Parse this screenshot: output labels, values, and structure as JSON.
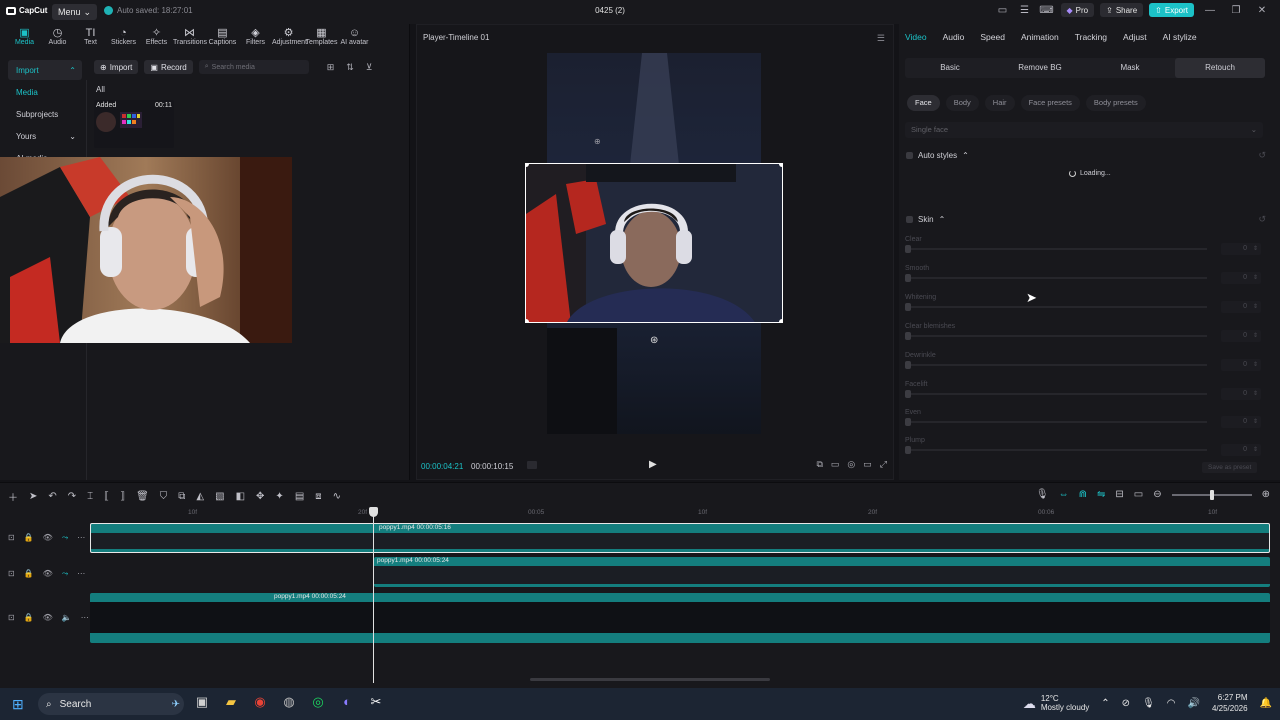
{
  "titlebar": {
    "app_name": "CapCut",
    "menu_label": "Menu",
    "autosave": "Auto saved: 18:27:01",
    "project_title": "0425 (2)",
    "pro_label": "Pro",
    "share_label": "Share",
    "export_label": "Export"
  },
  "tools": [
    {
      "label": "Media",
      "icon": "media-icon"
    },
    {
      "label": "Audio",
      "icon": "audio-icon"
    },
    {
      "label": "Text",
      "icon": "text-icon"
    },
    {
      "label": "Stickers",
      "icon": "stickers-icon"
    },
    {
      "label": "Effects",
      "icon": "effects-icon"
    },
    {
      "label": "Transitions",
      "icon": "transitions-icon"
    },
    {
      "label": "Captions",
      "icon": "captions-icon"
    },
    {
      "label": "Filters",
      "icon": "filters-icon"
    },
    {
      "label": "Adjustment",
      "icon": "adjustment-icon"
    },
    {
      "label": "Templates",
      "icon": "templates-icon"
    },
    {
      "label": "AI avatar",
      "icon": "ai-avatar-icon"
    }
  ],
  "leftnav": {
    "import": "Import",
    "media": "Media",
    "subprojects": "Subprojects",
    "yours": "Yours",
    "ai_media": "AI media"
  },
  "media": {
    "import_btn": "Import",
    "record_btn": "Record",
    "search_placeholder": "Search media",
    "all_label": "All",
    "thumb_added": "Added",
    "thumb_duration": "00:11"
  },
  "player": {
    "title": "Player-Timeline 01",
    "current_time": "00:00:04:21",
    "total_time": "00:00:10:15"
  },
  "right": {
    "tabs": [
      "Video",
      "Audio",
      "Speed",
      "Animation",
      "Tracking",
      "Adjust",
      "AI stylize"
    ],
    "subtabs": [
      "Basic",
      "Remove BG",
      "Mask",
      "Retouch"
    ],
    "chips": [
      "Face",
      "Body",
      "Hair",
      "Face presets",
      "Body presets"
    ],
    "dropdown": "Single face",
    "auto_styles": "Auto styles",
    "loading": "Loading...",
    "skin": "Skin",
    "sliders": [
      {
        "label": "Clear",
        "value": "0"
      },
      {
        "label": "Smooth",
        "value": "0"
      },
      {
        "label": "Whitening",
        "value": "0"
      },
      {
        "label": "Clear blemishes",
        "value": "0"
      },
      {
        "label": "Dewrinkle",
        "value": "0"
      },
      {
        "label": "Facelift",
        "value": "0"
      },
      {
        "label": "Even",
        "value": "0"
      },
      {
        "label": "Plump",
        "value": "0"
      }
    ],
    "save_preset": "Save as preset"
  },
  "timeline": {
    "ticks": [
      "10f",
      "20f",
      "00:05",
      "10f",
      "20f",
      "00:06",
      "10f"
    ],
    "clips": [
      {
        "label": "poppy1.mp4  00:00:05:16"
      },
      {
        "label": "poppy1.mp4  00:00:05:24"
      },
      {
        "label": "poppy1.mp4  00:00:05:24"
      }
    ]
  },
  "taskbar": {
    "search": "Search",
    "temp": "12°C",
    "weather": "Mostly cloudy",
    "time": "6:27 PM",
    "date": "4/25/2026"
  }
}
